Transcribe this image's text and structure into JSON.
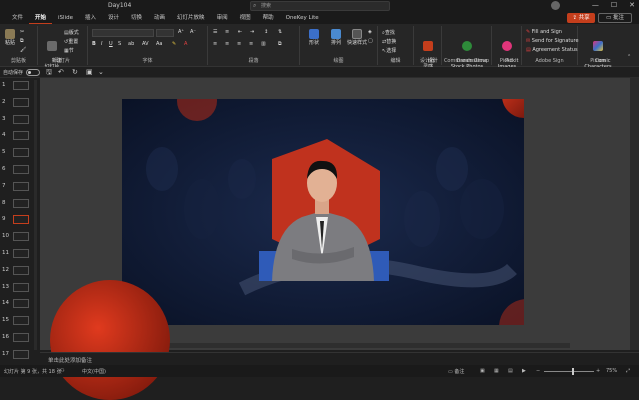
{
  "window": {
    "title": "Day104",
    "search_placeholder": "搜索",
    "minimize": "—",
    "maximize": "☐",
    "close": "✕"
  },
  "tabs": [
    "文件",
    "开始",
    "iSlide",
    "插入",
    "设计",
    "切换",
    "动画",
    "幻灯片放映",
    "审阅",
    "视图",
    "帮助",
    "OneKey Lite"
  ],
  "share_label": "共享",
  "comment_label": "批注",
  "ribbon": {
    "groups": {
      "clipboard": "剪贴板",
      "slides": "幻灯片",
      "font": "字体",
      "paragraph": "段落",
      "drawing": "绘图",
      "editing": "编辑",
      "designer": "设计器",
      "commands": "Commands Group",
      "pickit": "Pickit",
      "adobe": "Adobe Sign",
      "pixton": "Pixton"
    },
    "buttons": {
      "paste": "粘贴",
      "new_slide": "新建\n幻灯片",
      "layout": "版式",
      "reset": "重置",
      "section": "节",
      "shape": "形状",
      "arrange": "排列",
      "quick_styles": "快速样式",
      "find": "查找",
      "replace": "替换",
      "select": "选择",
      "design_ideas": "设计\n灵感",
      "dreamstime": "Dreamstime\nStock Photos",
      "pickit_images": "Pickit\nImages",
      "fill_sign": "Fill and Sign",
      "send_signature": "Send for Signature",
      "agreement_status": "Agreement Status",
      "comic_characters": "Comic\nCharacters"
    }
  },
  "quick_access": {
    "autosave": "自动保存",
    "toggle_state": "关"
  },
  "slides": [
    {
      "num": "1"
    },
    {
      "num": "2"
    },
    {
      "num": "3"
    },
    {
      "num": "4"
    },
    {
      "num": "5"
    },
    {
      "num": "6"
    },
    {
      "num": "7"
    },
    {
      "num": "8"
    },
    {
      "num": "9"
    },
    {
      "num": "10"
    },
    {
      "num": "11"
    },
    {
      "num": "12"
    },
    {
      "num": "13"
    },
    {
      "num": "14"
    },
    {
      "num": "15"
    },
    {
      "num": "16"
    },
    {
      "num": "17"
    }
  ],
  "selected_slide": 9,
  "notes_placeholder": "单击此处添加备注",
  "status": {
    "slide_info": "幻灯片 第 9 张，共 18 张",
    "language": "中文(中国)",
    "notes_btn": "备注",
    "zoom": "75%"
  },
  "colors": {
    "accent": "#c43e1c",
    "slide_bg": "#0d1730",
    "hexagon": "#c0321e",
    "blue_bar": "#2f5bb8"
  }
}
